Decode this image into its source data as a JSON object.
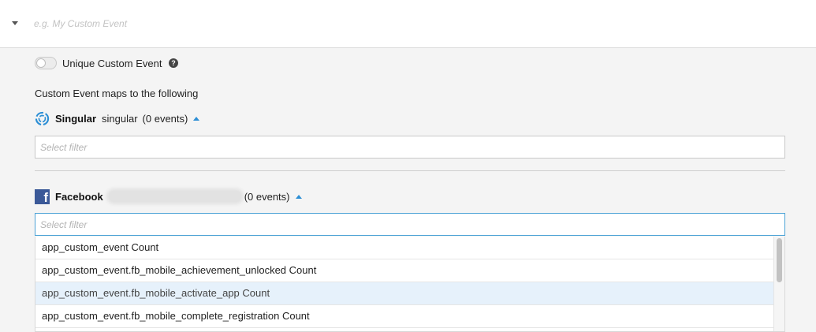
{
  "header": {
    "event_name_placeholder": "e.g. My Custom Event",
    "event_name_value": ""
  },
  "unique_toggle": {
    "label": "Unique Custom Event",
    "enabled": false,
    "help_glyph": "?"
  },
  "maps_label": "Custom Event maps to the following",
  "sources": [
    {
      "name": "Singular",
      "account": "singular",
      "count_label": "(0 events)",
      "icon": "singular-logo-icon",
      "filter_placeholder": "Select filter"
    },
    {
      "name": "Facebook",
      "account": "",
      "count_label": "(0 events)",
      "icon": "facebook-logo-icon",
      "icon_glyph": "f",
      "filter_placeholder": "Select filter"
    }
  ],
  "dropdown": {
    "options": [
      "app_custom_event Count",
      "app_custom_event.fb_mobile_achievement_unlocked Count",
      "app_custom_event.fb_mobile_activate_app Count",
      "app_custom_event.fb_mobile_complete_registration Count"
    ],
    "highlighted_index": 2
  },
  "colors": {
    "accent": "#2d8fd5",
    "facebook": "#3b5998",
    "highlight_row": "#e6f1fb",
    "active_border": "#4da3d6"
  }
}
